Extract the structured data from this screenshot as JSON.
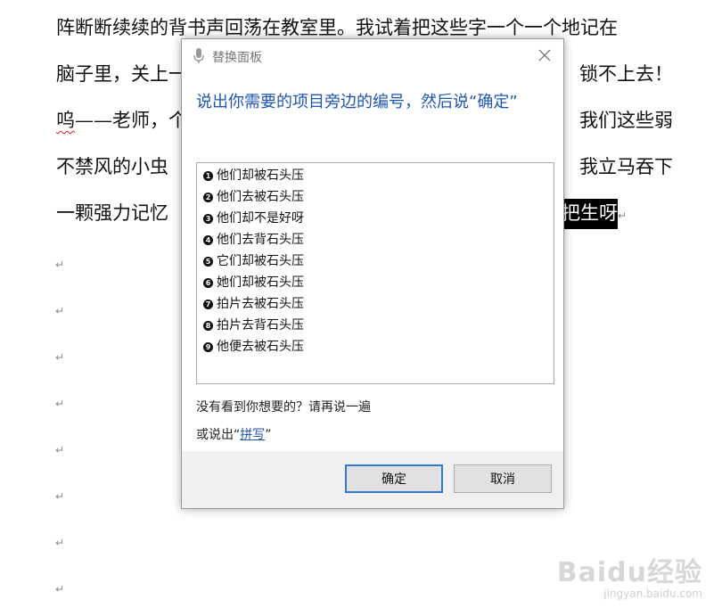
{
  "document": {
    "lines": [
      {
        "text": "阵断断续续的背书声回荡在教室里。我试着把这些字一个一个地记在",
        "prefix": "",
        "squiggle": "",
        "selected": ""
      },
      {
        "text": "脑子里，关上一",
        "prefix": "",
        "squiggle": "",
        "selected": "",
        "tail": "锁不上去！"
      },
      {
        "text": "——老师，个",
        "prefix": "",
        "squiggle": "呜",
        "selected": "",
        "tail": "我们这些弱"
      },
      {
        "text": "不禁风的小虫",
        "prefix": "",
        "squiggle": "",
        "selected": "",
        "tail": "我立马吞下"
      },
      {
        "text": "一颗强力记忆",
        "prefix": "",
        "squiggle": "",
        "selected": "把生呀",
        "tail": ""
      }
    ],
    "para_mark": "↵"
  },
  "dialog": {
    "title": "替换面板",
    "instruction": "说出你需要的项目旁边的编号，然后说“确定”",
    "items": [
      {
        "num": "1",
        "label": "他们却被石头压"
      },
      {
        "num": "2",
        "label": "他们去被石头压"
      },
      {
        "num": "3",
        "label": "他们却不是好呀"
      },
      {
        "num": "4",
        "label": "他们去背石头压"
      },
      {
        "num": "5",
        "label": "它们却被石头压"
      },
      {
        "num": "6",
        "label": "她们却被石头压"
      },
      {
        "num": "7",
        "label": "拍片去被石头压"
      },
      {
        "num": "8",
        "label": "拍片去背石头压"
      },
      {
        "num": "9",
        "label": "他便去被石头压"
      }
    ],
    "hint": "没有看到你想要的？请再说一遍",
    "alt_prefix": "或说出“",
    "alt_link": "拼写",
    "alt_suffix": "”",
    "ok_label": "确定",
    "cancel_label": "取消"
  },
  "watermark": {
    "main": "Baidu经验",
    "sub": "jingyan.baidu.com"
  },
  "colors": {
    "accent": "#1f56b3",
    "focus_border": "#2d7bd6"
  }
}
